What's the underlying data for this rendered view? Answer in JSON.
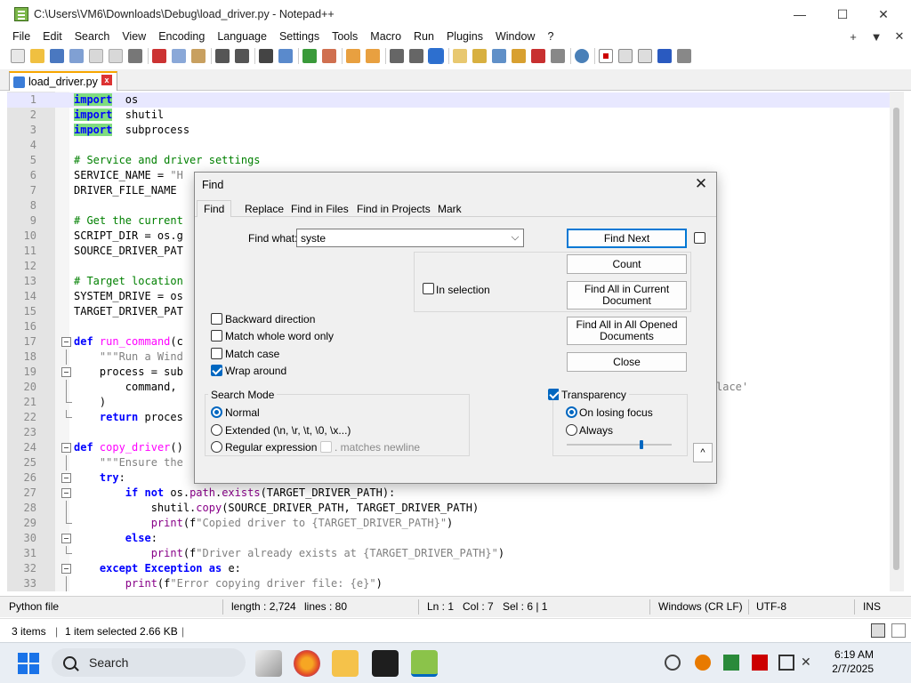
{
  "window": {
    "title": "C:\\Users\\VM6\\Downloads\\Debug\\load_driver.py - Notepad++",
    "minimize": "—",
    "maximize": "☐",
    "close": "✕"
  },
  "menu": {
    "items": [
      "File",
      "Edit",
      "Search",
      "View",
      "Encoding",
      "Language",
      "Settings",
      "Tools",
      "Macro",
      "Run",
      "Plugins",
      "Window",
      "?"
    ],
    "right_plus": "+",
    "right_down": "▼",
    "right_close": "✕"
  },
  "tab": {
    "label": "load_driver.py",
    "close": "x"
  },
  "editor": {
    "current_line": 1,
    "lines": [
      {
        "n": "1",
        "fold": "",
        "html_kind": "import_hl",
        "parts": [
          [
            "kwh",
            "import"
          ],
          [
            "",
            "  os"
          ]
        ]
      },
      {
        "n": "2",
        "fold": "",
        "parts": [
          [
            "kwh",
            "import"
          ],
          [
            "",
            "  shutil"
          ]
        ]
      },
      {
        "n": "3",
        "fold": "",
        "parts": [
          [
            "kwh",
            "import"
          ],
          [
            "",
            "  subprocess"
          ]
        ]
      },
      {
        "n": "4",
        "fold": "",
        "parts": []
      },
      {
        "n": "5",
        "fold": "",
        "parts": [
          [
            "cm",
            "# Service and driver settings"
          ]
        ]
      },
      {
        "n": "6",
        "fold": "",
        "parts": [
          [
            "",
            "SERVICE_NAME = "
          ],
          [
            "st",
            "\"H"
          ]
        ]
      },
      {
        "n": "7",
        "fold": "",
        "parts": [
          [
            "",
            "DRIVER_FILE_NAME"
          ]
        ]
      },
      {
        "n": "8",
        "fold": "",
        "parts": []
      },
      {
        "n": "9",
        "fold": "",
        "parts": [
          [
            "cm",
            "# Get the current"
          ]
        ]
      },
      {
        "n": "10",
        "fold": "",
        "parts": [
          [
            "",
            "SCRIPT_DIR = os.g"
          ]
        ]
      },
      {
        "n": "11",
        "fold": "",
        "parts": [
          [
            "",
            "SOURCE_DRIVER_PAT"
          ]
        ]
      },
      {
        "n": "12",
        "fold": "",
        "parts": []
      },
      {
        "n": "13",
        "fold": "",
        "parts": [
          [
            "cm",
            "# Target location"
          ]
        ]
      },
      {
        "n": "14",
        "fold": "",
        "parts": [
          [
            "",
            "SYSTEM_DRIVE = os"
          ]
        ]
      },
      {
        "n": "15",
        "fold": "",
        "parts": [
          [
            "",
            "TARGET_DRIVER_PAT"
          ]
        ]
      },
      {
        "n": "16",
        "fold": "",
        "parts": []
      },
      {
        "n": "17",
        "fold": "box",
        "parts": [
          [
            "kw",
            "def"
          ],
          [
            "",
            " "
          ],
          [
            "fn",
            "run_command"
          ],
          [
            "",
            "(c"
          ]
        ]
      },
      {
        "n": "18",
        "fold": "line",
        "parts": [
          [
            "",
            "    "
          ],
          [
            "st",
            "\"\"\"Run a Wind"
          ]
        ]
      },
      {
        "n": "19",
        "fold": "box",
        "parts": [
          [
            "",
            "    process = sub"
          ]
        ]
      },
      {
        "n": "20",
        "fold": "line",
        "parts": [
          [
            "",
            "        command, "
          ]
        ]
      },
      {
        "n": "21",
        "fold": "end",
        "parts": [
          [
            "",
            "    )"
          ]
        ]
      },
      {
        "n": "22",
        "fold": "end",
        "parts": [
          [
            "",
            "    "
          ],
          [
            "kw",
            "return"
          ],
          [
            "",
            " proces"
          ]
        ]
      },
      {
        "n": "23",
        "fold": "",
        "parts": []
      },
      {
        "n": "24",
        "fold": "box",
        "parts": [
          [
            "kw",
            "def"
          ],
          [
            "",
            " "
          ],
          [
            "fn",
            "copy_driver"
          ],
          [
            "",
            "()"
          ]
        ]
      },
      {
        "n": "25",
        "fold": "line",
        "parts": [
          [
            "",
            "    "
          ],
          [
            "st",
            "\"\"\"Ensure the"
          ]
        ]
      },
      {
        "n": "26",
        "fold": "box",
        "parts": [
          [
            "",
            "    "
          ],
          [
            "kw",
            "try"
          ],
          [
            "",
            ":"
          ]
        ]
      },
      {
        "n": "27",
        "fold": "box",
        "parts": [
          [
            "",
            "        "
          ],
          [
            "kw",
            "if not"
          ],
          [
            "",
            " os."
          ],
          [
            "bi",
            "path"
          ],
          [
            "",
            "."
          ],
          [
            "bi",
            "exists"
          ],
          [
            "",
            "(TARGET_DRIVER_PATH):"
          ]
        ]
      },
      {
        "n": "28",
        "fold": "line",
        "parts": [
          [
            "",
            "            shutil."
          ],
          [
            "bi",
            "copy"
          ],
          [
            "",
            "(SOURCE_DRIVER_PATH, TARGET_DRIVER_PATH)"
          ]
        ]
      },
      {
        "n": "29",
        "fold": "end",
        "parts": [
          [
            "",
            "            "
          ],
          [
            "bi",
            "print"
          ],
          [
            "",
            "(f"
          ],
          [
            "st",
            "\"Copied driver to {TARGET_DRIVER_PATH}\""
          ],
          [
            "",
            ")"
          ]
        ]
      },
      {
        "n": "30",
        "fold": "box",
        "parts": [
          [
            "",
            "        "
          ],
          [
            "kw",
            "else"
          ],
          [
            "",
            ":"
          ]
        ]
      },
      {
        "n": "31",
        "fold": "end",
        "parts": [
          [
            "",
            "            "
          ],
          [
            "bi",
            "print"
          ],
          [
            "",
            "(f"
          ],
          [
            "st",
            "\"Driver already exists at {TARGET_DRIVER_PATH}\""
          ],
          [
            "",
            ")"
          ]
        ]
      },
      {
        "n": "32",
        "fold": "box",
        "parts": [
          [
            "",
            "    "
          ],
          [
            "kw",
            "except"
          ],
          [
            "",
            " "
          ],
          [
            "kw",
            "Exception"
          ],
          [
            "",
            " "
          ],
          [
            "kw",
            "as"
          ],
          [
            "",
            " e:"
          ]
        ]
      },
      {
        "n": "33",
        "fold": "line",
        "parts": [
          [
            "",
            "        "
          ],
          [
            "bi",
            "print"
          ],
          [
            "",
            "(f"
          ],
          [
            "st",
            "\"Error copying driver file: {e}\""
          ],
          [
            "",
            ")"
          ]
        ]
      }
    ],
    "line20_tail": "lace'"
  },
  "status": {
    "lang": "Python file",
    "length": "length : 2,724",
    "lines": "lines : 80",
    "ln": "Ln : 1",
    "col": "Col : 7",
    "sel": "Sel : 6 | 1",
    "eol": "Windows (CR LF)",
    "enc": "UTF-8",
    "ins": "INS"
  },
  "explorer": {
    "items": "3 items",
    "selected": "1 item selected  2.66 KB"
  },
  "taskbar": {
    "search_label": "Search",
    "time": "6:19 AM",
    "date": "2/7/2025"
  },
  "find": {
    "title": "Find",
    "close": "✕",
    "tabs": [
      "Find",
      "Replace",
      "Find in Files",
      "Find in Projects",
      "Mark"
    ],
    "find_what_label": "Find what:",
    "find_what_value": "syste",
    "in_selection": "In selection",
    "backward": "Backward direction",
    "whole_word": "Match whole word only",
    "match_case": "Match case",
    "wrap_around": "Wrap around",
    "search_mode_title": "Search Mode",
    "mode_normal": "Normal",
    "mode_extended": "Extended (\\n, \\r, \\t, \\0, \\x...)",
    "mode_regex": "Regular expression",
    "matches_newline": ". matches newline",
    "transparency": "Transparency",
    "on_losing_focus": "On losing focus",
    "always": "Always",
    "btn_find_next": "Find Next",
    "btn_count": "Count",
    "btn_find_all_current_1": "Find All in Current",
    "btn_find_all_current_2": "Document",
    "btn_find_all_opened_1": "Find All in All Opened",
    "btn_find_all_opened_2": "Documents",
    "btn_close": "Close",
    "collapse": "^",
    "wrap_checked": true,
    "transparency_checked": true,
    "mode": "Normal",
    "transparency_mode": "On losing focus"
  },
  "colors": {
    "keyword": "#0000ff",
    "keyword_highlight": "#7fdc7f",
    "comment": "#008000",
    "string": "#808080",
    "function": "#ff00ff",
    "accent": "#0067c0"
  }
}
